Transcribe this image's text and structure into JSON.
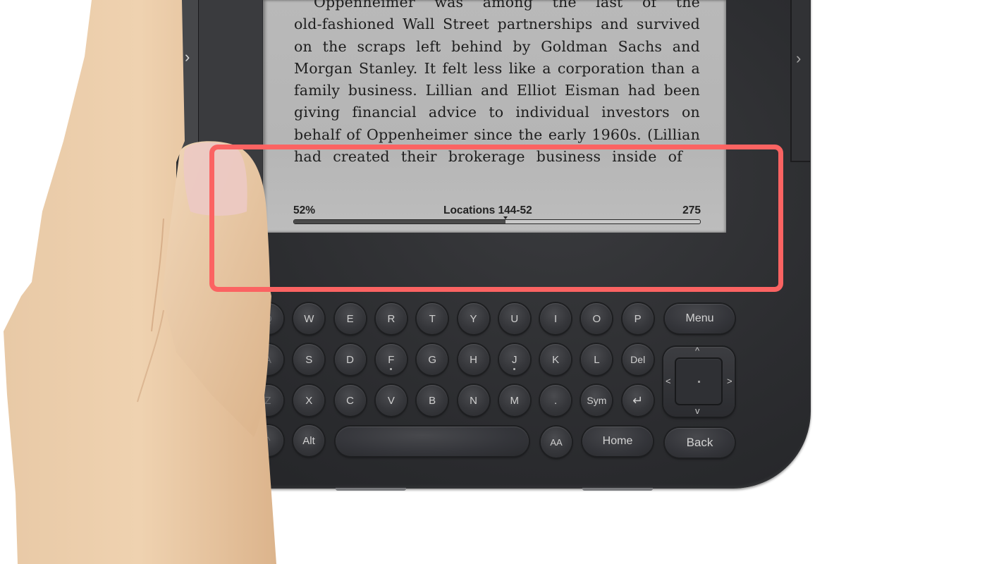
{
  "device": {
    "page_turn_left_glyph": "›",
    "page_turn_right_glyph": "›"
  },
  "book": {
    "lines": [
      "Oppenheimer was among the last of the",
      "old-fashioned Wall Street partnerships and survived",
      "on the scraps left behind by Goldman Sachs and",
      "Morgan Stanley. It felt less like a corporation than a",
      "family business. Lillian and Elliot Eisman had been",
      "giving financial advice to individual investors on",
      "behalf of Oppenheimer since the early 1960s. (Lillian",
      "had created their brokerage business inside of"
    ]
  },
  "status": {
    "percent_label": "52%",
    "locations_label": "Locations 144-52",
    "total_label": "275",
    "progress_fraction": 0.52
  },
  "keyboard": {
    "row1": [
      "Q",
      "W",
      "E",
      "R",
      "T",
      "Y",
      "U",
      "I",
      "O",
      "P"
    ],
    "row2": [
      "A",
      "S",
      "D",
      "F",
      "G",
      "H",
      "J",
      "K",
      "L",
      "Del"
    ],
    "row3": [
      "Z",
      "X",
      "C",
      "V",
      "B",
      "N",
      "M",
      ".",
      "Sym",
      "↵"
    ],
    "shift_glyph": "^",
    "alt_label": "Alt",
    "font_size_label": "AA",
    "menu_label": "Menu",
    "home_label": "Home",
    "back_label": "Back",
    "dpad": {
      "up": "^",
      "down": "v",
      "left": "<",
      "right": ">"
    }
  },
  "highlight": {
    "color": "#fb6362",
    "target": "reading progress / status bar"
  }
}
